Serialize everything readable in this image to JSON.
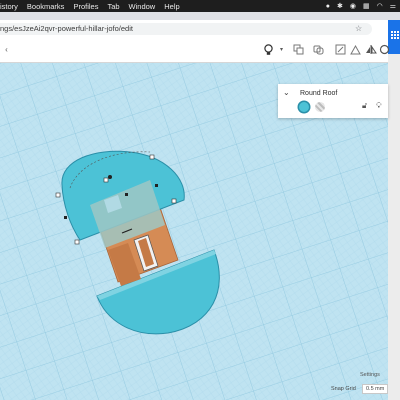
{
  "menubar": {
    "items": [
      "istory",
      "Bookmarks",
      "Profiles",
      "Tab",
      "Window",
      "Help"
    ]
  },
  "browser": {
    "url": "ngs/esJzeAi2qvr-powerful-hillar-jofo/edit"
  },
  "inspector": {
    "title": "Round Roof"
  },
  "footer": {
    "settings_label": "Settings",
    "snap_grid_label": "Snap Grid",
    "snap_grid_value": "0.5 mm"
  },
  "colors": {
    "workplane": "#bfe3f1",
    "roof_fill": "#4cc2d6",
    "roof_stroke": "#2a8fa8",
    "house": "#d58b55",
    "accent": "#1a73e8"
  },
  "icons": [
    "lightbulb-icon",
    "copy-icon",
    "duplicate-icon",
    "delete-icon",
    "group-icon",
    "ungroup-icon",
    "align-icon",
    "mirror-icon",
    "lock-icon",
    "visible-icon"
  ]
}
